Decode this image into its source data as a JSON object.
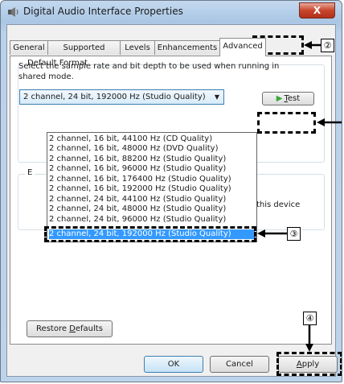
{
  "window": {
    "title": "Digital Audio Interface Properties",
    "close_label": "X"
  },
  "tabs": [
    {
      "label": "General"
    },
    {
      "label": "Supported Formats"
    },
    {
      "label": "Levels"
    },
    {
      "label": "Enhancements"
    },
    {
      "label": "Advanced"
    }
  ],
  "default_format": {
    "group_label": "Default Format",
    "description": "Select the sample rate and bit depth to be used when running in shared mode.",
    "selected_value": "2 channel, 24 bit, 192000 Hz (Studio Quality)",
    "test_button_prefix": "",
    "test_button_accel": "T",
    "test_button_rest": "est",
    "options": [
      "2 channel, 16 bit, 44100 Hz (CD Quality)",
      "2 channel, 16 bit, 48000 Hz (DVD Quality)",
      "2 channel, 16 bit, 88200 Hz (Studio Quality)",
      "2 channel, 16 bit, 96000 Hz (Studio Quality)",
      "2 channel, 16 bit, 176400 Hz (Studio Quality)",
      "2 channel, 16 bit, 192000 Hz (Studio Quality)",
      "2 channel, 24 bit, 44100 Hz (Studio Quality)",
      "2 channel, 24 bit, 48000 Hz (Studio Quality)",
      "2 channel, 24 bit, 96000 Hz (Studio Quality)",
      "2 channel, 24 bit, 192000 Hz (Studio Quality)"
    ]
  },
  "exclusive": {
    "group_label": "E",
    "text_fragment": "this device"
  },
  "buttons": {
    "restore_prefix": "Restore ",
    "restore_accel": "D",
    "restore_rest": "efaults",
    "ok": "OK",
    "cancel": "Cancel",
    "apply_accel": "A",
    "apply_rest": "pply"
  },
  "callouts": {
    "c2": "②",
    "c3": "③",
    "c4": "④"
  },
  "colors": {
    "selection": "#3399ff",
    "close_button": "#c8452c",
    "title_bar": "#aac6e4"
  }
}
